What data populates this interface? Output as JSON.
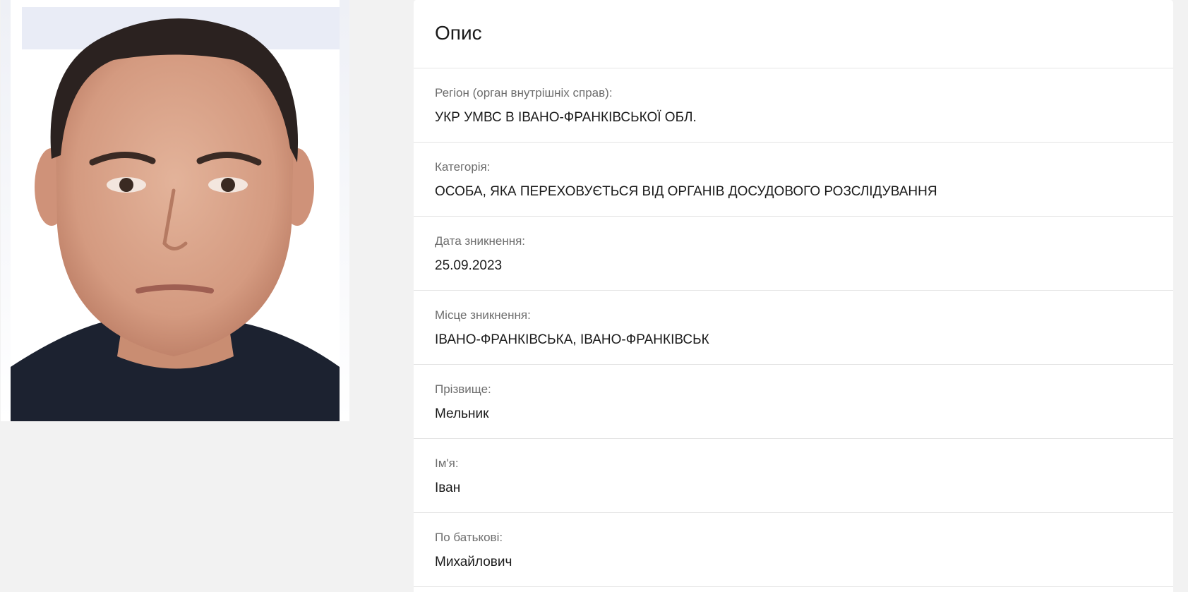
{
  "card": {
    "title": "Опис"
  },
  "fields": [
    {
      "label": "Регіон (орган внутрішніх справ):",
      "value": "УКР УМВС В ІВАНО-ФРАНКІВСЬКОЇ ОБЛ."
    },
    {
      "label": "Категорія:",
      "value": "ОСОБА, ЯКА ПЕРЕХОВУЄТЬСЯ ВІД ОРГАНІВ ДОСУДОВОГО РОЗСЛІДУВАННЯ"
    },
    {
      "label": "Дата зникнення:",
      "value": "25.09.2023"
    },
    {
      "label": "Місце зникнення:",
      "value": "ІВАНО-ФРАНКІВСЬКА, ІВАНО-ФРАНКІВСЬК"
    },
    {
      "label": "Прізвище:",
      "value": "Мельник"
    },
    {
      "label": "Ім'я:",
      "value": "Іван"
    },
    {
      "label": "По батькові:",
      "value": "Михайлович"
    }
  ],
  "colors": {
    "page_background": "#f2f2f2",
    "card_background": "#ffffff",
    "label_text": "#6d6d6d",
    "value_text": "#1a1a1a",
    "divider": "#e4e4e4"
  }
}
